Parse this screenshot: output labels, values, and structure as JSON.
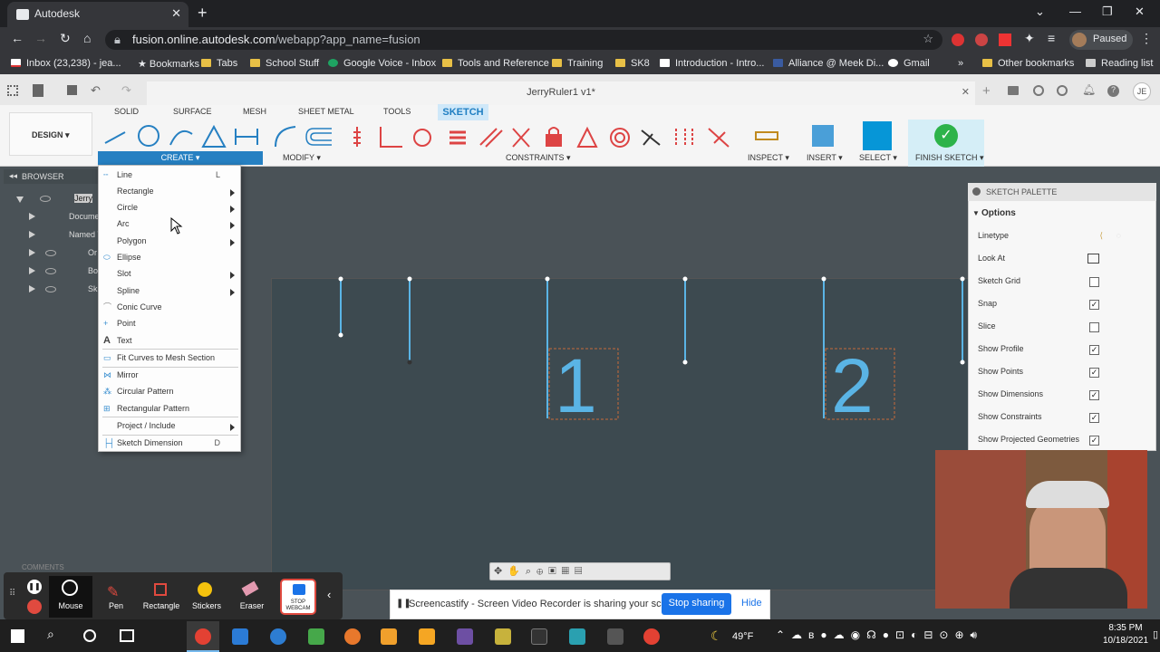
{
  "browser": {
    "tab_title": "Autodesk",
    "url_host": "fusion.online.autodesk.com",
    "url_path": "/webapp?app_name=fusion",
    "profile_status": "Paused",
    "bookmarks": [
      "Inbox (23,238) - jea...",
      "Bookmarks",
      "Tabs",
      "School Stuff",
      "Google Voice - Inbox",
      "Tools and Reference",
      "Training",
      "SK8",
      "Introduction - Intro...",
      "Alliance @ Meek Di...",
      "Gmail",
      "»",
      "Other bookmarks",
      "Reading list"
    ]
  },
  "fusion": {
    "doc_title": "JerryRuler1 v1*",
    "user_initials": "JE",
    "design_label": "DESIGN",
    "ribbon_tabs": [
      "SOLID",
      "SURFACE",
      "MESH",
      "SHEET METAL",
      "TOOLS",
      "SKETCH"
    ],
    "groups": {
      "create": "CREATE ▾",
      "modify": "MODIFY ▾",
      "constraints": "CONSTRAINTS ▾",
      "inspect": "INSPECT ▾",
      "insert": "INSERT ▾",
      "select": "SELECT ▾",
      "finish": "FINISH SKETCH ▾"
    },
    "browser_panel": {
      "title": "BROWSER",
      "rows": [
        "Jerry",
        "Docume",
        "Named V",
        "Or",
        "Bo",
        "Sk"
      ]
    },
    "comments_label": "COMMENTS",
    "create_menu": {
      "items": [
        {
          "label": "Line",
          "shortcut": "L",
          "icon": "line-icon"
        },
        {
          "label": "Rectangle",
          "submenu": true
        },
        {
          "label": "Circle",
          "submenu": true
        },
        {
          "label": "Arc",
          "submenu": true
        },
        {
          "label": "Polygon",
          "submenu": true
        },
        {
          "label": "Ellipse",
          "icon": "ellipse-icon"
        },
        {
          "label": "Slot",
          "submenu": true
        },
        {
          "label": "Spline",
          "submenu": true
        },
        {
          "label": "Conic Curve",
          "icon": "conic-icon"
        },
        {
          "label": "Point",
          "icon": "point-icon"
        },
        {
          "label": "Text",
          "icon": "text-icon"
        },
        {
          "label": "Fit Curves to Mesh Section",
          "icon": "fit-icon"
        },
        {
          "label": "Mirror",
          "icon": "mirror-icon"
        },
        {
          "label": "Circular Pattern",
          "icon": "circular-pattern-icon"
        },
        {
          "label": "Rectangular Pattern",
          "icon": "rect-pattern-icon"
        },
        {
          "label": "Project / Include",
          "submenu": true
        },
        {
          "label": "Sketch Dimension",
          "shortcut": "D",
          "icon": "dimension-icon"
        }
      ]
    },
    "sketch_palette": {
      "title": "SKETCH PALETTE",
      "section": "Options",
      "rows": [
        {
          "label": "Linetype",
          "type": "icon"
        },
        {
          "label": "Look At",
          "type": "icon"
        },
        {
          "label": "Sketch Grid",
          "checked": false
        },
        {
          "label": "Snap",
          "checked": true
        },
        {
          "label": "Slice",
          "checked": false
        },
        {
          "label": "Show Profile",
          "checked": true
        },
        {
          "label": "Show Points",
          "checked": true
        },
        {
          "label": "Show Dimensions",
          "checked": true
        },
        {
          "label": "Show Constraints",
          "checked": true
        },
        {
          "label": "Show Projected Geometries",
          "checked": true
        }
      ]
    },
    "canvas_numbers": [
      "1",
      "2"
    ]
  },
  "screencastify": {
    "tools": [
      "Mouse",
      "Pen",
      "Rectangle",
      "Stickers",
      "Eraser",
      "STOP WEBCAM"
    ],
    "share_text": "Screencastify - Screen Video Recorder is sharing your screen.",
    "stop_label": "Stop sharing",
    "hide_label": "Hide"
  },
  "taskbar": {
    "temperature": "49°F",
    "time": "8:35 PM",
    "date": "10/18/2021"
  },
  "colors": {
    "accent": "#2680c2",
    "sketch_line": "#5ab4e5",
    "finish_green": "#2db34a"
  }
}
